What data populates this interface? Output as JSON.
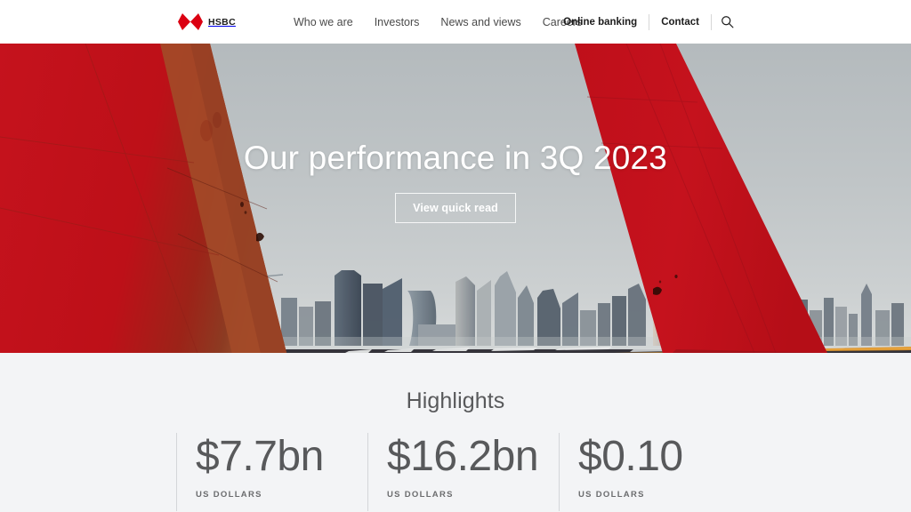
{
  "nav": {
    "logo_word": "HSBC",
    "logo_icon": "hsbc-hexagon-logo",
    "main_links": [
      {
        "label": "Who we are"
      },
      {
        "label": "Investors"
      },
      {
        "label": "News and views"
      },
      {
        "label": "Careers"
      }
    ],
    "online_banking": "Online banking",
    "contact": "Contact",
    "search_icon": "search-icon"
  },
  "hero": {
    "title": "Our performance in 3Q 2023",
    "cta_label": "View quick read",
    "image_description": "red ship hull bow with city skyline and road"
  },
  "highlights": {
    "title": "Highlights",
    "stats": [
      {
        "value": "$7.7bn",
        "label": "US DOLLARS"
      },
      {
        "value": "$16.2bn",
        "label": "US DOLLARS"
      },
      {
        "value": "$0.10",
        "label": "US DOLLARS"
      }
    ]
  },
  "colors": {
    "brand_red": "#db0011",
    "hull_red": "#c2101c",
    "text_dark": "#1c1c1c",
    "text_gray": "#58595b",
    "highlights_bg": "#f3f4f6"
  }
}
